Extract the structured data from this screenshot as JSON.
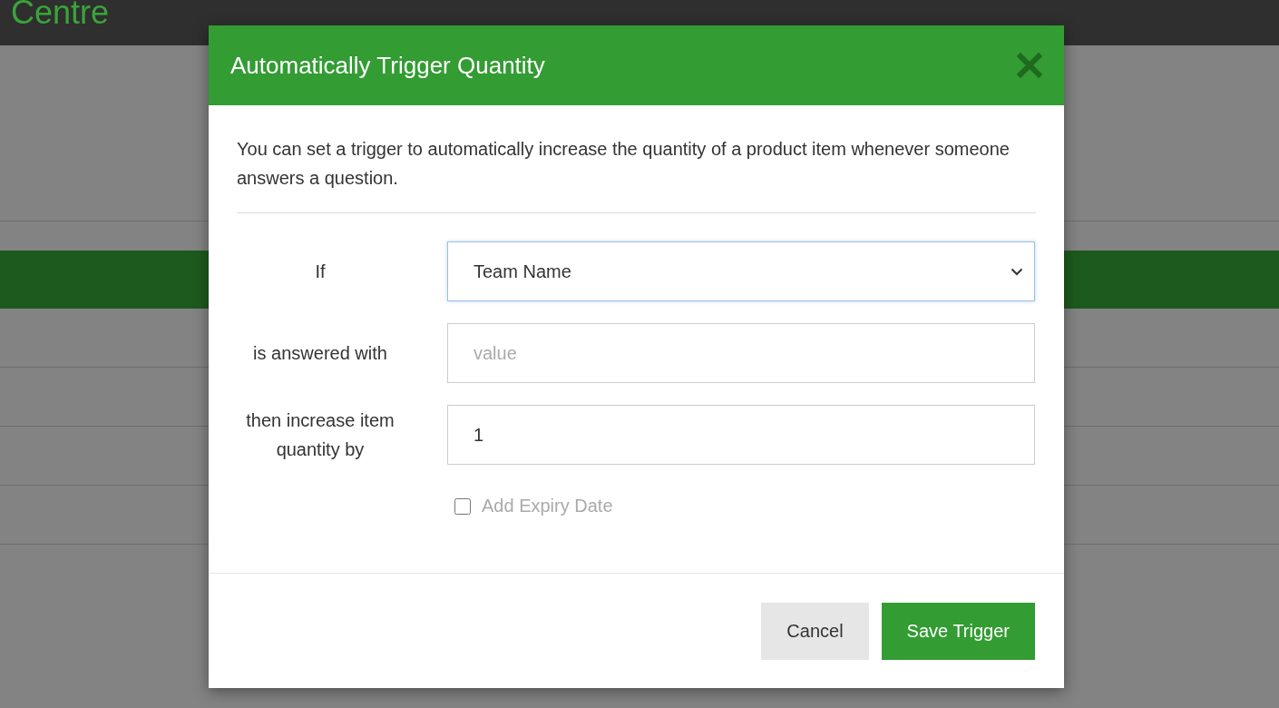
{
  "page": {
    "title": "Centre"
  },
  "dialog": {
    "title": "Automatically Trigger Quantity",
    "description": "You can set a trigger to automatically increase the quantity of a product item whenever someone answers a question.",
    "fields": [
      {
        "kind": "select",
        "label": "If",
        "value": "Team Name",
        "focused": true
      },
      {
        "kind": "text",
        "label": "is answered with",
        "placeholder": "value",
        "focused": false
      },
      {
        "kind": "text",
        "label": "then increase item quantity by",
        "value": "1",
        "focused": false
      }
    ],
    "expiry": {
      "label": "Add Expiry Date",
      "checked": false
    },
    "buttons": [
      {
        "kind": "secondary",
        "label": "Cancel"
      },
      {
        "kind": "primary",
        "label": "Save Trigger"
      }
    ]
  }
}
